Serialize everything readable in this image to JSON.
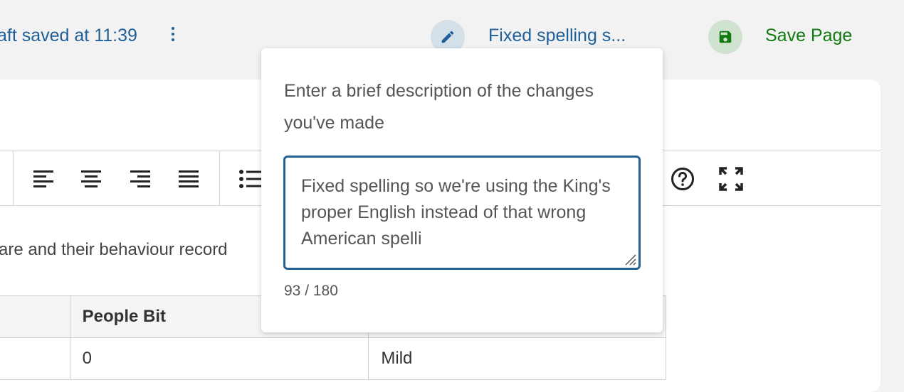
{
  "header": {
    "draft_status": "aft saved at 11:39",
    "summary_link": "Fixed spelling s...",
    "save_label": "Save Page"
  },
  "content": {
    "body_text": "are and their behaviour record"
  },
  "table": {
    "headers": [
      "",
      "People Bit",
      ""
    ],
    "rows": [
      [
        "",
        "0",
        "Mild"
      ]
    ]
  },
  "popover": {
    "prompt": "Enter a brief description of the changes you've made",
    "summary_value": "Fixed spelling so we're using the King's proper English instead of that wrong American spelli",
    "char_count": "93 / 180"
  },
  "colors": {
    "link_blue": "#1f5f99",
    "save_green": "#117a11",
    "focus_border": "#236195"
  },
  "icons": [
    "more-vertical-icon",
    "pencil-icon",
    "floppy-disk-icon",
    "align-left-icon",
    "align-center-icon",
    "align-right-icon",
    "align-justify-icon",
    "bulleted-list-icon",
    "help-circle-icon",
    "fullscreen-icon",
    "resize-grip-icon"
  ]
}
